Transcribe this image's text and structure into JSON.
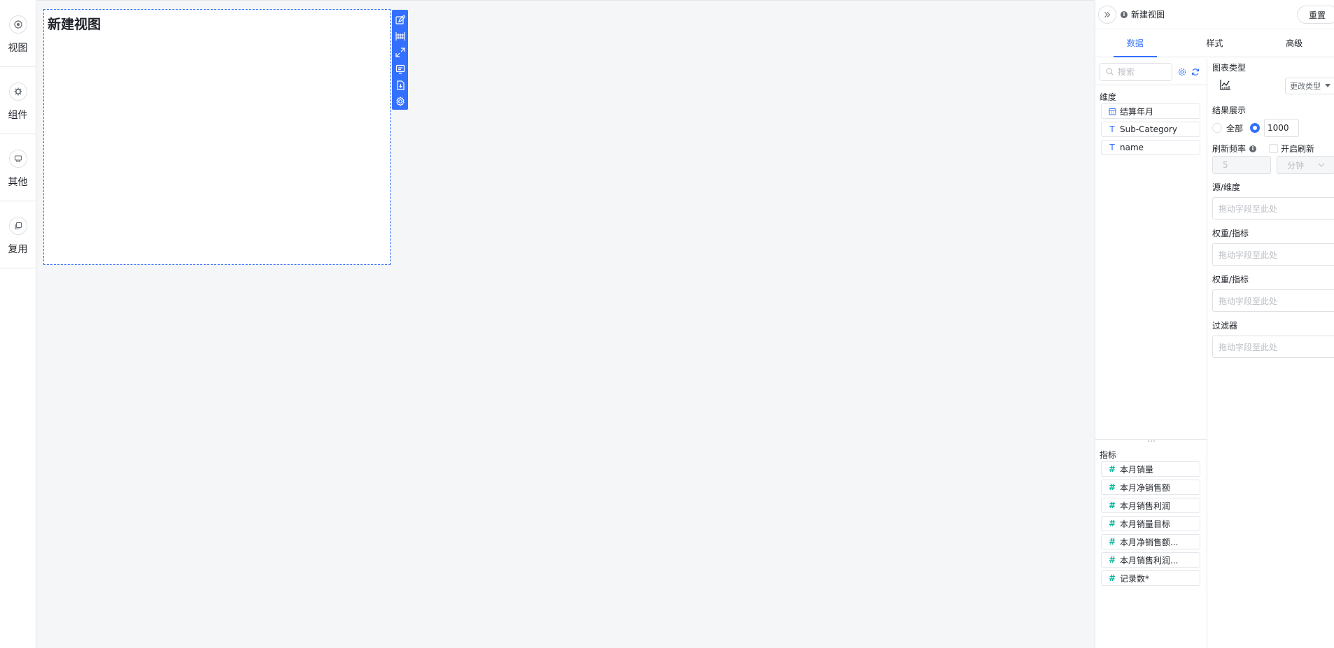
{
  "rail": {
    "items": [
      {
        "label": "视图",
        "icon": "view-icon"
      },
      {
        "label": "组件",
        "icon": "component-icon"
      },
      {
        "label": "其他",
        "icon": "other-icon"
      },
      {
        "label": "复用",
        "icon": "reuse-icon"
      }
    ]
  },
  "canvas": {
    "view_title": "新建视图"
  },
  "panel": {
    "view_name": "新建视图",
    "reset_label": "重置",
    "tabs": [
      {
        "label": "数据",
        "active": true
      },
      {
        "label": "样式",
        "active": false
      },
      {
        "label": "高级",
        "active": false
      }
    ],
    "search_placeholder": "搜索",
    "dimension_title": "维度",
    "dimensions": [
      {
        "label": "结算年月",
        "type": "date"
      },
      {
        "label": "Sub-Category",
        "type": "text"
      },
      {
        "label": "name",
        "type": "text"
      }
    ],
    "measure_title": "指标",
    "measures": [
      {
        "label": "本月销量"
      },
      {
        "label": "本月净销售额"
      },
      {
        "label": "本月销售利润"
      },
      {
        "label": "本月销量目标"
      },
      {
        "label": "本月净销售额..."
      },
      {
        "label": "本月销售利润..."
      },
      {
        "label": "记录数*"
      }
    ],
    "config": {
      "chart_type_label": "图表类型",
      "change_type_label": "更改类型",
      "result_label": "结果展示",
      "result_all_label": "全部",
      "result_count": "1000",
      "refresh_label": "刷新频率",
      "enable_refresh_label": "开启刷新",
      "refresh_value": "5",
      "refresh_unit": "分钟",
      "drop_placeholder": "拖动字段至此处",
      "drop_zones": [
        {
          "label": "源/维度"
        },
        {
          "label": "权重/指标"
        },
        {
          "label": "权重/指标"
        },
        {
          "label": "过滤器"
        }
      ]
    }
  },
  "colors": {
    "primary": "#3370ff",
    "measure": "#04b49c",
    "border": "#dee0e3"
  }
}
